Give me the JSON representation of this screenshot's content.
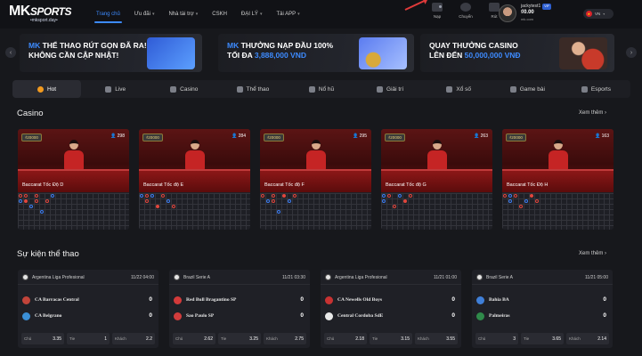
{
  "logo": {
    "brand_mk": "MK",
    "brand_sports": "SPORTS",
    "domain": "•mksport.day•"
  },
  "nav": [
    {
      "label": "Trang chủ",
      "caret": false,
      "active": true
    },
    {
      "label": "Ưu đãi",
      "caret": true,
      "active": false
    },
    {
      "label": "Nhà tài trợ",
      "caret": true,
      "active": false
    },
    {
      "label": "CSKH",
      "caret": false,
      "active": false
    },
    {
      "label": "ĐẠI LÝ",
      "caret": true,
      "active": false
    },
    {
      "label": "Tải APP",
      "caret": true,
      "active": false
    }
  ],
  "actions": [
    {
      "label": "Nạp",
      "icon": "wallet-icon"
    },
    {
      "label": "Chuyển",
      "icon": "transfer-icon"
    },
    {
      "label": "Rút",
      "icon": "withdraw-icon"
    }
  ],
  "user": {
    "name": "jackytest1",
    "vip": "VIP",
    "balance": "₫0.00",
    "id": "mk.com"
  },
  "language": {
    "code": "VN"
  },
  "banners": [
    {
      "line1_pre": "MK",
      "line1": " THỂ THAO RÚT GỌN ĐÃ RA!",
      "line2": "KHÔNG CẦN CẬP NHẬT!",
      "line2_blue": ""
    },
    {
      "line1_pre": "MK",
      "line1": " THƯỞNG NẠP ĐẦU 100%",
      "line2": "TỐI ĐA ",
      "line2_blue": "3,888,000 VND"
    },
    {
      "line1_pre": "",
      "line1": "QUAY THƯỞNG CASINO",
      "line2": "LÊN ĐẾN ",
      "line2_blue": "50,000,000 VNĐ"
    }
  ],
  "categories": [
    {
      "label": "Hot",
      "icon": "hot-icon",
      "active": true
    },
    {
      "label": "Live",
      "icon": "live-icon",
      "active": false
    },
    {
      "label": "Casino",
      "icon": "casino-icon",
      "active": false
    },
    {
      "label": "Thể thao",
      "icon": "sports-icon",
      "active": false
    },
    {
      "label": "Nổ hũ",
      "icon": "slots-icon",
      "active": false
    },
    {
      "label": "Giải trí",
      "icon": "entertainment-icon",
      "active": false
    },
    {
      "label": "Xổ số",
      "icon": "lottery-icon",
      "active": false
    },
    {
      "label": "Game bài",
      "icon": "card-game-icon",
      "active": false
    },
    {
      "label": "Esports",
      "icon": "esports-icon",
      "active": false
    }
  ],
  "casino": {
    "title": "Casino",
    "see_more": "Xem thêm ›",
    "tables": [
      {
        "tag": "₫20000",
        "viewers": "298",
        "name": "Baccarat Tốc Độ D"
      },
      {
        "tag": "₫20000",
        "viewers": "284",
        "name": "Baccarat Tốc độ E"
      },
      {
        "tag": "₫20000",
        "viewers": "295",
        "name": "Baccarat Tốc độ F"
      },
      {
        "tag": "₫20000",
        "viewers": "263",
        "name": "Baccarat Tốc độ G"
      },
      {
        "tag": "₫20000",
        "viewers": "163",
        "name": "Baccarat Tốc Độ H"
      }
    ]
  },
  "sports": {
    "title": "Sự kiện thể thao",
    "see_more": "Xem thêm ›",
    "matches": [
      {
        "league": "Argentina Liga Profesional",
        "time": "11/22 04:00",
        "home": "CA Barracas Central",
        "home_score": "0",
        "home_color": "#c2443a",
        "away": "CA Belgrano",
        "away_score": "0",
        "away_color": "#3b8fd6",
        "odds": [
          {
            "label": "Chủ",
            "value": "3.35"
          },
          {
            "label": "Tie",
            "value": "1"
          },
          {
            "label": "Khách",
            "value": "2.2"
          }
        ]
      },
      {
        "league": "Brazil Serie A",
        "time": "11/21 03:30",
        "home": "Red Bull Bragantino SP",
        "home_score": "0",
        "home_color": "#d33a3a",
        "away": "Sao Paulo SP",
        "away_score": "0",
        "away_color": "#d23c3c",
        "odds": [
          {
            "label": "Chủ",
            "value": "2.62"
          },
          {
            "label": "Tie",
            "value": "3.25"
          },
          {
            "label": "Khách",
            "value": "2.75"
          }
        ]
      },
      {
        "league": "Argentina Liga Profesional",
        "time": "11/21 01:00",
        "home": "CA Newells Old Boys",
        "home_score": "0",
        "home_color": "#c83232",
        "away": "Central Cordoba SdE",
        "away_score": "0",
        "away_color": "#e8e8e8",
        "odds": [
          {
            "label": "Chủ",
            "value": "2.18"
          },
          {
            "label": "Tie",
            "value": "3.15"
          },
          {
            "label": "Khách",
            "value": "3.55"
          }
        ]
      },
      {
        "league": "Brazil Serie A",
        "time": "11/21 05:00",
        "home": "Bahia BA",
        "home_score": "0",
        "home_color": "#3f7fd8",
        "away": "Palmeiras",
        "away_score": "0",
        "away_color": "#2f8a4a",
        "odds": [
          {
            "label": "Chủ",
            "value": "3"
          },
          {
            "label": "Tie",
            "value": "3.65"
          },
          {
            "label": "Khách",
            "value": "2.14"
          }
        ]
      }
    ]
  },
  "colors": {
    "accent": "#3d8bff",
    "hot": "#f29a1f",
    "banker": "#e2463d",
    "player": "#3d7ef2"
  }
}
